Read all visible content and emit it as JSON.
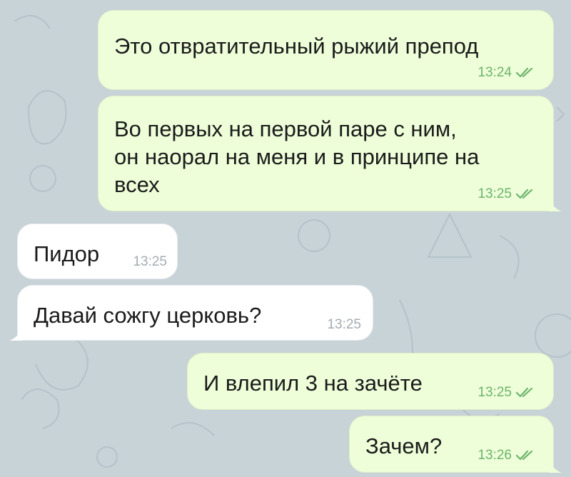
{
  "chat": {
    "messages": [
      {
        "direction": "out",
        "text": "Это отвратительный рыжий препод",
        "time": "13:24",
        "read": true
      },
      {
        "direction": "out",
        "text": "Во первых на первой паре с ним,\nон наорал на меня и в принципе на\nвсех",
        "time": "13:25",
        "read": true
      },
      {
        "direction": "in",
        "text": "Пидор",
        "time": "13:25"
      },
      {
        "direction": "in",
        "text": "Давай сожгу церковь?",
        "time": "13:25"
      },
      {
        "direction": "out",
        "text": "И влепил 3 на зачёте",
        "time": "13:25",
        "read": true
      },
      {
        "direction": "out",
        "text": "Зачем?",
        "time": "13:26",
        "read": true
      }
    ]
  },
  "icons": {
    "read_receipt": "double-check-icon",
    "wallpaper": "doodle-pattern"
  },
  "colors": {
    "background": "#c8d3d8",
    "outgoing_bubble": "#eefed9",
    "incoming_bubble": "#ffffff",
    "outgoing_meta": "#6cb46c",
    "incoming_meta": "#a3acb1"
  }
}
